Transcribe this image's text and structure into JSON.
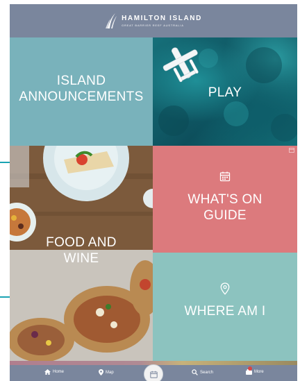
{
  "header": {
    "brand": "HAMILTON ISLAND",
    "tagline": "GREAT BARRIER REEF AUSTRALIA"
  },
  "tiles": {
    "announcements": {
      "line1": "ISLAND",
      "line2": "ANNOUNCEMENTS"
    },
    "play": {
      "label": "PLAY"
    },
    "food": {
      "line1": "FOOD AND",
      "line2": "WINE"
    },
    "whats_on": {
      "line1": "WHAT'S ON",
      "line2": "GUIDE",
      "icon": "calendar-icon"
    },
    "where": {
      "label": "WHERE AM I",
      "icon": "location-pin-icon"
    }
  },
  "tabbar": {
    "home": "Home",
    "map": "Map",
    "center_icon": "calendar-icon",
    "search": "Search",
    "more": "More"
  },
  "colors": {
    "header": "#7a869d",
    "announcements": "#79b2bb",
    "whats_on": "#dc7a7d",
    "where": "#8cc3bf",
    "guide_marks": "#1aa3b3"
  }
}
